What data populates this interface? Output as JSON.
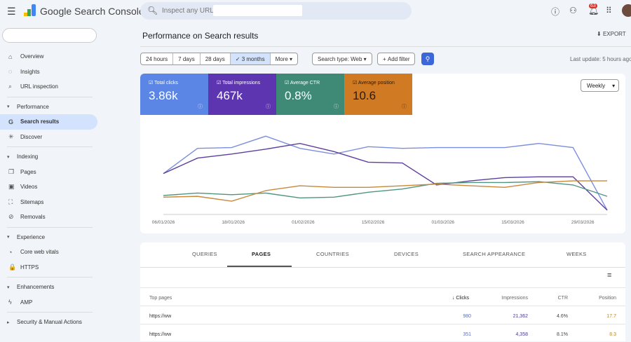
{
  "header": {
    "brand": "Google Search Console",
    "search_placeholder": "Inspect any URL in",
    "notifications": "63"
  },
  "sidebar": {
    "items": [
      {
        "label": "Overview",
        "icon": "⌂",
        "type": "item"
      },
      {
        "label": "Insights",
        "icon": "◌",
        "type": "item"
      },
      {
        "label": "URL inspection",
        "icon": "⌕",
        "type": "item"
      },
      {
        "label": "Performance",
        "icon": "▾",
        "type": "section"
      },
      {
        "label": "Search results",
        "icon": "G",
        "type": "item",
        "active": true
      },
      {
        "label": "Discover",
        "icon": "✳",
        "type": "item"
      },
      {
        "label": "Indexing",
        "icon": "▾",
        "type": "section"
      },
      {
        "label": "Pages",
        "icon": "❐",
        "type": "item"
      },
      {
        "label": "Videos",
        "icon": "▣",
        "type": "item"
      },
      {
        "label": "Sitemaps",
        "icon": "⛶",
        "type": "item"
      },
      {
        "label": "Removals",
        "icon": "⊘",
        "type": "item"
      },
      {
        "label": "Experience",
        "icon": "▾",
        "type": "section"
      },
      {
        "label": "Core web vitals",
        "icon": "◔",
        "type": "item"
      },
      {
        "label": "HTTPS",
        "icon": "🔒",
        "type": "item"
      },
      {
        "label": "Enhancements",
        "icon": "▾",
        "type": "section"
      },
      {
        "label": "AMP",
        "icon": "ϟ",
        "type": "item"
      },
      {
        "label": "Security & Manual Actions",
        "icon": "▸",
        "type": "section"
      }
    ]
  },
  "page": {
    "title": "Performance on Search results",
    "export": "EXPORT",
    "last_update": "Last update: 5 hours ago"
  },
  "filters": {
    "ranges": [
      "24 hours",
      "7 days",
      "28 days",
      "3 months",
      "More"
    ],
    "selected": "3 months",
    "search_type": "Search type: Web",
    "add_filter": "Add filter"
  },
  "metrics": [
    {
      "label": "Total clicks",
      "value": "3.86k",
      "color": "#5b86e5"
    },
    {
      "label": "Total impressions",
      "value": "467k",
      "color": "#5e35b1"
    },
    {
      "label": "Average CTR",
      "value": "0.8%",
      "color": "#3f8a76"
    },
    {
      "label": "Average position",
      "value": "10.6",
      "color": "#d07a24",
      "dark": true
    }
  ],
  "granularity": "Weekly",
  "chart_data": {
    "type": "line",
    "x_ticks": [
      "06/01/2026",
      "18/01/2026",
      "01/02/2026",
      "15/02/2026",
      "01/03/2026",
      "15/03/2026",
      "29/03/2026"
    ],
    "note": "relative scale, no y axis shown",
    "series": [
      {
        "name": "Total clicks",
        "color": "#7b8fde",
        "values": [
          46,
          77,
          78,
          92,
          77,
          70,
          79,
          77,
          78,
          78,
          78,
          83,
          78,
          1
        ]
      },
      {
        "name": "Total impressions",
        "color": "#5e3f9e",
        "values": [
          46,
          65,
          70,
          76,
          83,
          73,
          60,
          59,
          32,
          37,
          41,
          42,
          42,
          1
        ]
      },
      {
        "name": "Average CTR",
        "color": "#4e9580",
        "values": [
          19,
          22,
          20,
          22,
          16,
          17,
          23,
          27,
          34,
          35,
          35,
          36,
          32,
          18
        ]
      },
      {
        "name": "Average position",
        "color": "#c8873a",
        "values": [
          17,
          18,
          12,
          25,
          31,
          29,
          29,
          31,
          33,
          31,
          29,
          35,
          37,
          37
        ]
      }
    ]
  },
  "table": {
    "tabs": [
      "QUERIES",
      "PAGES",
      "COUNTRIES",
      "DEVICES",
      "SEARCH APPEARANCE",
      "WEEKS"
    ],
    "selected_tab": "PAGES",
    "headers": [
      "Top pages",
      "Clicks",
      "Impressions",
      "CTR",
      "Position"
    ],
    "rows": [
      [
        "https://ww",
        "980",
        "21,362",
        "4.6%",
        "17.7"
      ],
      [
        "https://ww",
        "351",
        "4,358",
        "8.1%",
        "8.3"
      ]
    ]
  }
}
